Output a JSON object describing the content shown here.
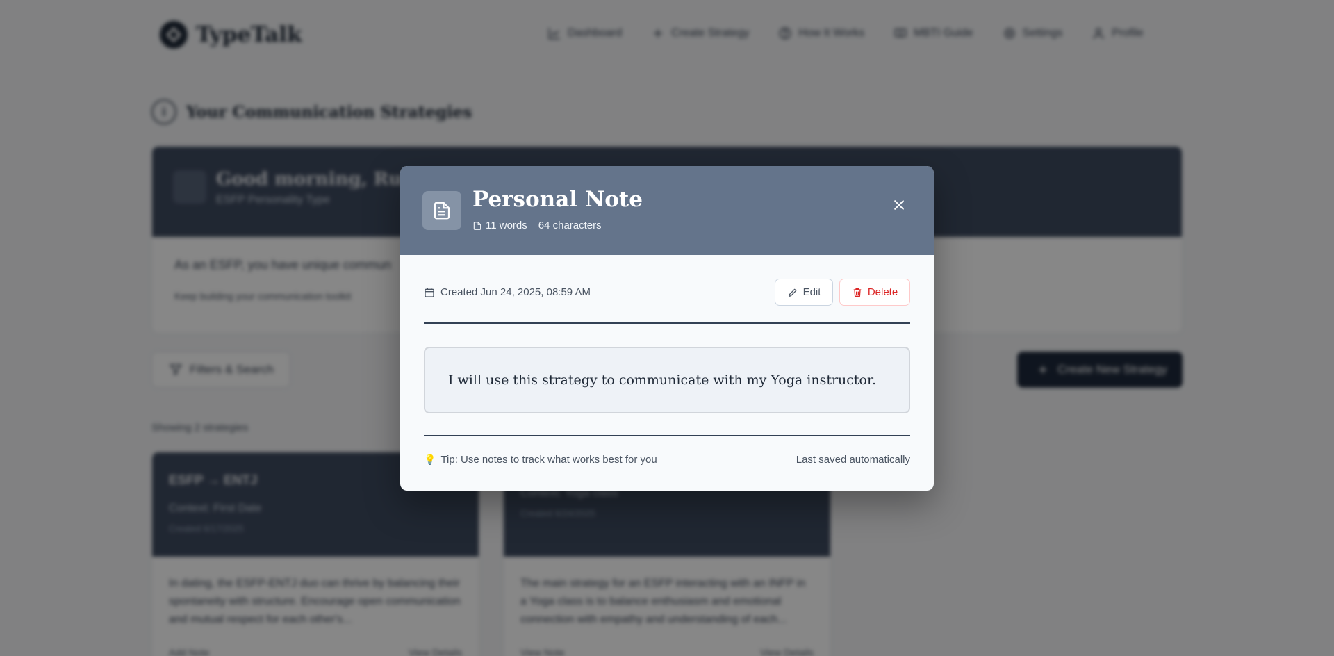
{
  "app": {
    "name": "TypeTalk"
  },
  "nav": {
    "items": [
      {
        "label": "Dashboard",
        "icon": "chart-icon"
      },
      {
        "label": "Create Strategy",
        "icon": "plus-icon"
      },
      {
        "label": "How It Works",
        "icon": "help-icon"
      },
      {
        "label": "MBTI Guide",
        "icon": "book-icon"
      },
      {
        "label": "Settings",
        "icon": "gear-icon"
      },
      {
        "label": "Profile",
        "icon": "user-icon"
      }
    ]
  },
  "page": {
    "title": "Your Communication Strategies",
    "welcome": {
      "greeting": "Good morning, Rupa D",
      "personality_type": "ESFP Personality Type",
      "text": "As an ESFP, you have unique commun",
      "hint": "Keep building your communication toolkit"
    },
    "filters_label": "Filters & Search",
    "create_label": "Create New Strategy",
    "showing": "Showing 2 strategies"
  },
  "strategies": [
    {
      "title": "ESFP → ENTJ",
      "context": "Context: First Date",
      "created": "Created 6/17/2025",
      "body": "In dating, the ESFP-ENTJ duo can thrive by balancing their spontaneity with structure. Encourage open communication and mutual respect for each other's...",
      "footer_left": "Add Note",
      "footer_right": "View Details"
    },
    {
      "title": "",
      "context": "Context: Yoga class",
      "created": "Created 6/24/2025",
      "body": "The main strategy for an ESFP interacting with an INFP in a Yoga class is to balance enthusiasm and emotional connection with empathy and understanding of each...",
      "footer_left": "View Note",
      "footer_right": "View Details"
    }
  ],
  "modal": {
    "title": "Personal Note",
    "word_count": "11 words",
    "char_count": "64 characters",
    "created": "Created Jun 24, 2025, 08:59 AM",
    "edit_label": "Edit",
    "delete_label": "Delete",
    "note": "I will use this strategy to communicate with my Yoga instructor.",
    "tip": "Tip: Use notes to track what works best for you",
    "saved": "Last saved automatically"
  },
  "colors": {
    "modal_header": "#64748b",
    "delete": "#dc2626",
    "primary_dark": "#1e293b"
  }
}
